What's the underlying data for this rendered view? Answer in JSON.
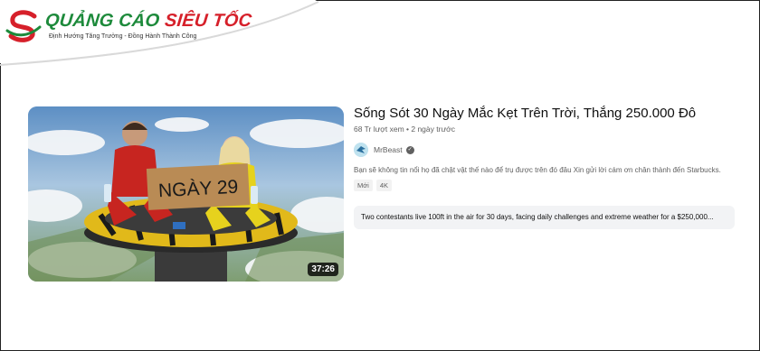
{
  "logo": {
    "brand_green": "QUẢNG CÁO",
    "brand_red": "SIÊU TỐC",
    "tagline": "Định Hướng Tăng Trưởng - Đồng Hành Thành Công"
  },
  "video": {
    "title": "Sống Sót 30 Ngày Mắc Kẹt Trên Trời, Thắng 250.000 Đô",
    "meta": "68 Tr lượt xem • 2 ngày trước",
    "channel": "MrBeast",
    "description": "Bạn sẽ không tin nổi họ đã chật vật thế nào để trụ được trên đó đâu Xin gửi lời cám ơn chân thành đến Starbucks.",
    "badges": [
      "Mới",
      "4K"
    ],
    "duration": "37:26",
    "sign_text": "NGÀY 29",
    "summary": "Two contestants live 100ft in the air for 30 days, facing daily challenges and extreme weather for a $250,000..."
  },
  "icons": {
    "verified": "verified-check-icon",
    "avatar": "channel-avatar-icon"
  },
  "colors": {
    "brand_green": "#1d8a3b",
    "brand_red": "#d6202a",
    "muted": "#606060"
  }
}
